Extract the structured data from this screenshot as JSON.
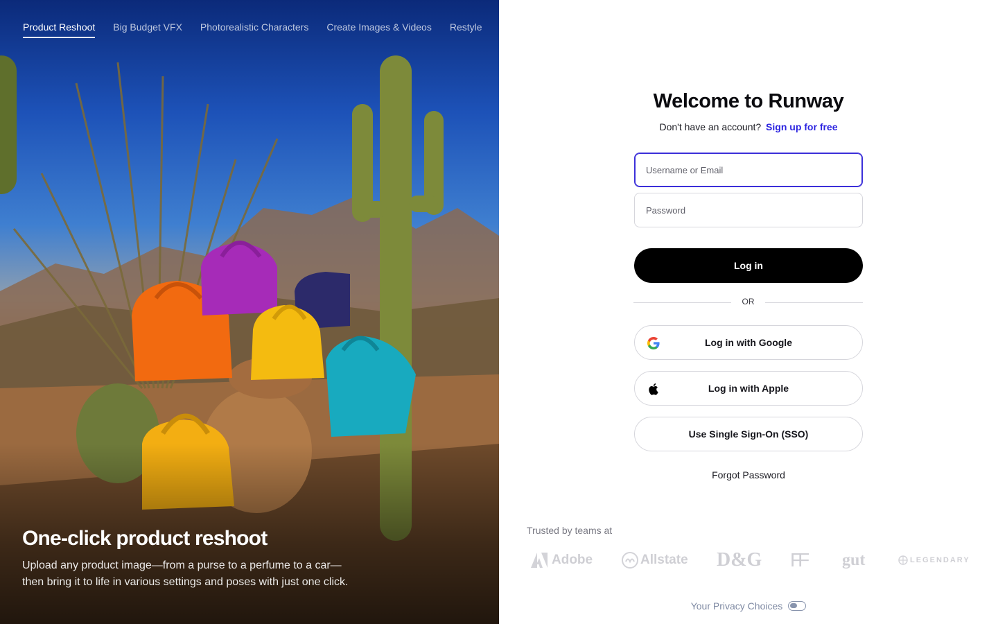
{
  "hero": {
    "tabs": [
      {
        "label": "Product Reshoot",
        "active": true
      },
      {
        "label": "Big Budget VFX",
        "active": false
      },
      {
        "label": "Photorealistic Characters",
        "active": false
      },
      {
        "label": "Create Images & Videos",
        "active": false
      },
      {
        "label": "Restyle",
        "active": false
      }
    ],
    "title": "One-click product reshoot",
    "description_line1": "Upload any product image—from a purse to a perfume to a car—",
    "description_line2": "then bring it to life in various settings and poses with just one click."
  },
  "login": {
    "title": "Welcome to Runway",
    "no_account_text": "Don't have an account?",
    "signup_link": "Sign up for free",
    "username_placeholder": "Username or Email",
    "password_placeholder": "Password",
    "login_button": "Log in",
    "or_text": "OR",
    "google_button": "Log in with Google",
    "apple_button": "Log in with Apple",
    "sso_button": "Use Single Sign-On (SSO)",
    "forgot_password": "Forgot Password"
  },
  "trusted": {
    "label": "Trusted by teams at",
    "logos": [
      "Adobe",
      "Allstate",
      "D&G",
      "FF",
      "gut",
      "LEGENDARY"
    ]
  },
  "footer": {
    "privacy": "Your Privacy Choices"
  },
  "colors": {
    "accent_link": "#2c24e0",
    "focus_border": "#3b2fd9",
    "primary_button": "#000000",
    "logo_gray": "#cfcfd4"
  }
}
